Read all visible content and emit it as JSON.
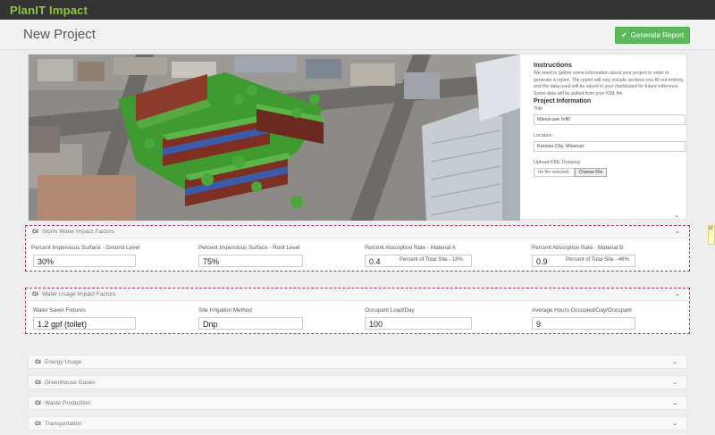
{
  "app": {
    "logo": "PlanIT Impact"
  },
  "header": {
    "page_title": "New Project",
    "generate_button": "Generate Report"
  },
  "instructions": {
    "title": "Instructions",
    "text": "We need to gather some information about your project in order to generate a report. The report will only include sections you fill out entirely, and the data used will be saved in your dashboard for future reference. Some data will be pulled from your KML file."
  },
  "project_info": {
    "title": "Project Information",
    "title_label": "Title",
    "title_value": "Mixed-use Infill",
    "location_label": "Location",
    "location_value": "Kansas City, Missouri",
    "upload_label": "Upload KML Drawing",
    "file_status": "No file selected.",
    "file_button": "Choose File"
  },
  "storm_water": {
    "title": "Storm Water Impact Factors",
    "icon": "GI",
    "fields": [
      {
        "label": "Percent Impervious Surface - Ground Level",
        "value": "30%"
      },
      {
        "label": "Percent Impervious Surface - Roof Level",
        "value": "75%"
      },
      {
        "label": "Percent Absorption Rate - Material A",
        "value": "0.4",
        "note": "Percent of Total Site - 18%"
      },
      {
        "label": "Percent Absorption Rate - Material B",
        "value": "0.9",
        "note": "Percent of Total Site - 46%"
      }
    ]
  },
  "water_usage": {
    "title": "Water Usage Impact Factors",
    "icon": "GI",
    "fields": [
      {
        "label": "Water Saver Fixtures",
        "value": "1.2 gpf (toilet)"
      },
      {
        "label": "Site Irrigation Method",
        "value": "Drip"
      },
      {
        "label": "Occupant Load/Day",
        "value": "100"
      },
      {
        "label": "Average Hours Occupied/Day/Occupant",
        "value": "9"
      }
    ]
  },
  "collapsed_sections": [
    {
      "icon": "GI",
      "title": "Energy Usage"
    },
    {
      "icon": "GI",
      "title": "Greenhouse Gases"
    },
    {
      "icon": "GI",
      "title": "Waste Production"
    },
    {
      "icon": "GI",
      "title": "Transportation"
    }
  ],
  "chevron": "⌄",
  "right_tab": "W",
  "colors": {
    "brand_green": "#8cc63f",
    "button_green": "#5cb85c",
    "highlight_dash": "#b03060",
    "topbar": "#333333"
  }
}
